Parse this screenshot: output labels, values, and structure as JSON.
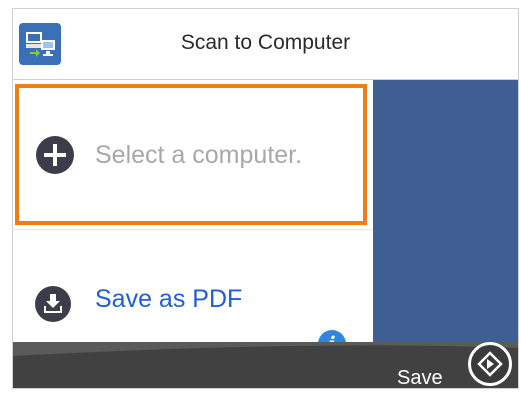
{
  "header": {
    "title": "Scan to Computer",
    "icon": "scan-to-computer-icon"
  },
  "items": {
    "select_computer": {
      "label": "Select a computer.",
      "icon": "plus-icon"
    },
    "save_format": {
      "label": "Save as PDF",
      "icon": "download-icon"
    }
  },
  "footer": {
    "save_label": "Save",
    "start_icon": "start-diamond-icon",
    "info_icon_glyph": "i"
  },
  "colors": {
    "accent": "#f07d14",
    "panel": "#3f5f93",
    "link": "#1f5fd6",
    "info": "#2e86de"
  }
}
